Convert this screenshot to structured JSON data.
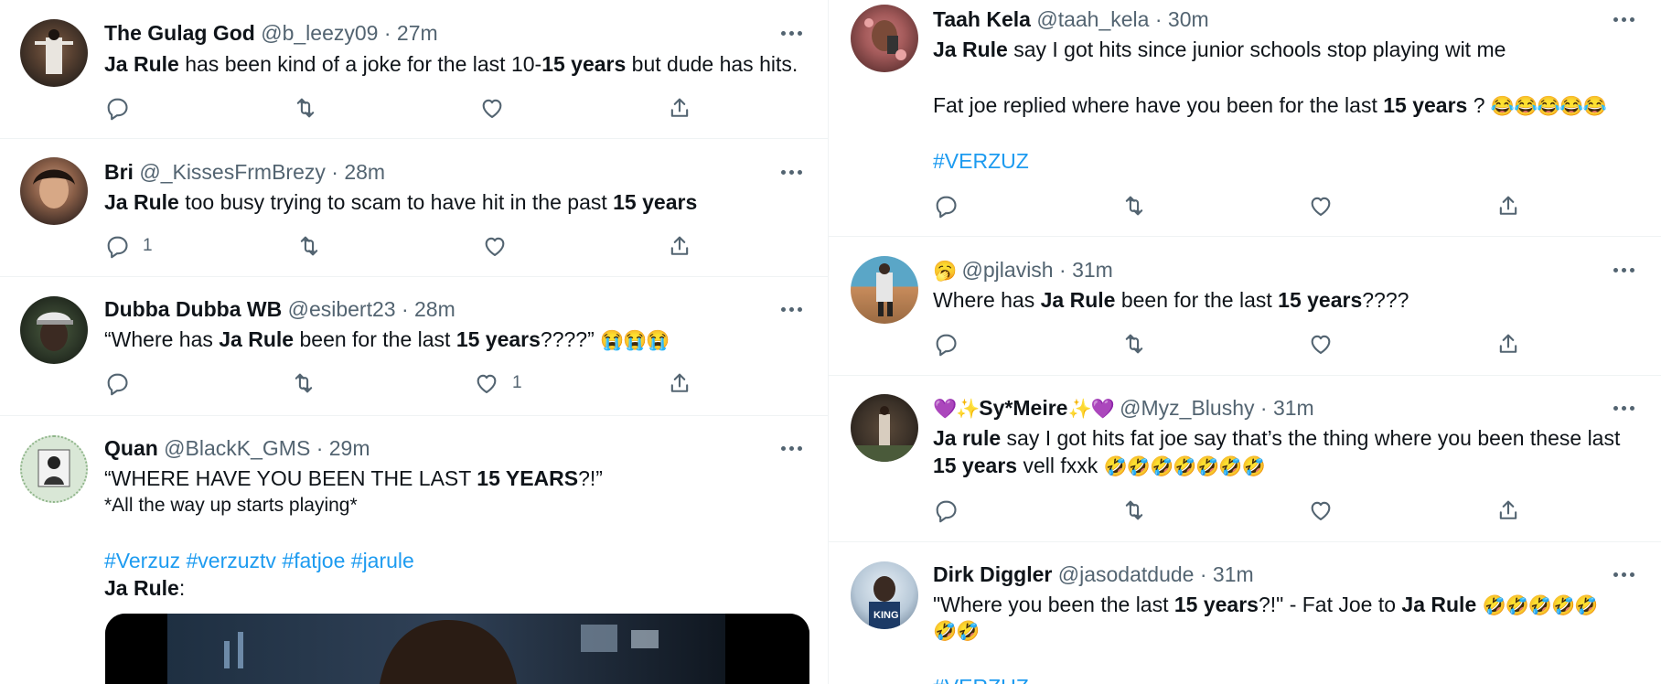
{
  "colors": {
    "text": "#0f1419",
    "secondary": "#536471",
    "link": "#1d9bf0",
    "border": "#eff3f4"
  },
  "icons": {
    "reply": "reply-icon",
    "retweet": "retweet-icon",
    "like": "heart-icon",
    "share": "share-icon",
    "more": "more-icon"
  },
  "left": [
    {
      "name": "The Gulag God",
      "handle": "@b_leezy09",
      "dot": "·",
      "time": "27m",
      "text": [
        "Ja Rule",
        " has been kind of a joke for the last 10-",
        "15 years",
        " but dude has hits."
      ],
      "reply_count": "",
      "like_count": ""
    },
    {
      "name": "Bri",
      "handle": "@_KissesFrmBrezy",
      "dot": "·",
      "time": "28m",
      "text": [
        "Ja Rule",
        " too busy trying to scam to have hit in the past ",
        "15 years"
      ],
      "reply_count": "1",
      "like_count": ""
    },
    {
      "name": "Dubba Dubba WB",
      "handle": "@esibert23",
      "dot": "·",
      "time": "28m",
      "text": [
        "“Where has ",
        "Ja Rule",
        " been for the last ",
        "15 years",
        "????” ",
        "😭😭😭"
      ],
      "reply_count": "",
      "like_count": "1"
    },
    {
      "name": "Quan",
      "handle": "@BlackK_GMS",
      "dot": "·",
      "time": "29m",
      "line1": [
        "“WHERE HAVE YOU BEEN THE LAST ",
        "15 YEARS",
        "?!”"
      ],
      "line2": " *All the way up starts playing*",
      "hashtags": [
        "#Verzuz",
        "#verzuztv",
        "#fatjoe",
        "#jarule"
      ],
      "line4": [
        "Ja Rule",
        ":"
      ]
    }
  ],
  "right": [
    {
      "name": "Taah Kela",
      "handle": "@taah_kela",
      "dot": "·",
      "time": "30m",
      "line1": [
        "Ja Rule",
        " say I got hits since junior schools stop playing  wit me"
      ],
      "line2": [
        "Fat joe replied where have you been for the last ",
        "15 years",
        " ? ",
        "😂😂😂😂😂"
      ],
      "hashtag": "#VERZUZ"
    },
    {
      "name_emoji": "🥱",
      "handle": "@pjlavish",
      "dot": "·",
      "time": "31m",
      "text": [
        "Where has ",
        "Ja Rule",
        " been for the last ",
        "15 years",
        "????"
      ]
    },
    {
      "name_pre": "💜✨",
      "name": "Sy*Meire",
      "name_post": "✨💜",
      "handle": "@Myz_Blushy",
      "dot": "·",
      "time": "31m",
      "line1": [
        "Ja rule",
        " say I got hits fat joe say that’s the thing where you been these last"
      ],
      "line2": [
        "15 years",
        " vell fxxk ",
        "🤣🤣🤣🤣🤣🤣🤣"
      ]
    },
    {
      "name": "Dirk Diggler",
      "handle": "@jasodatdude",
      "dot": "·",
      "time": "31m",
      "line1": [
        "\"Where you been the last ",
        "15 years",
        "?!\" - Fat Joe to ",
        "Ja Rule",
        " ",
        "🤣🤣🤣🤣🤣"
      ],
      "line2": "🤣🤣",
      "hashtag": "#VERZUZ"
    }
  ]
}
